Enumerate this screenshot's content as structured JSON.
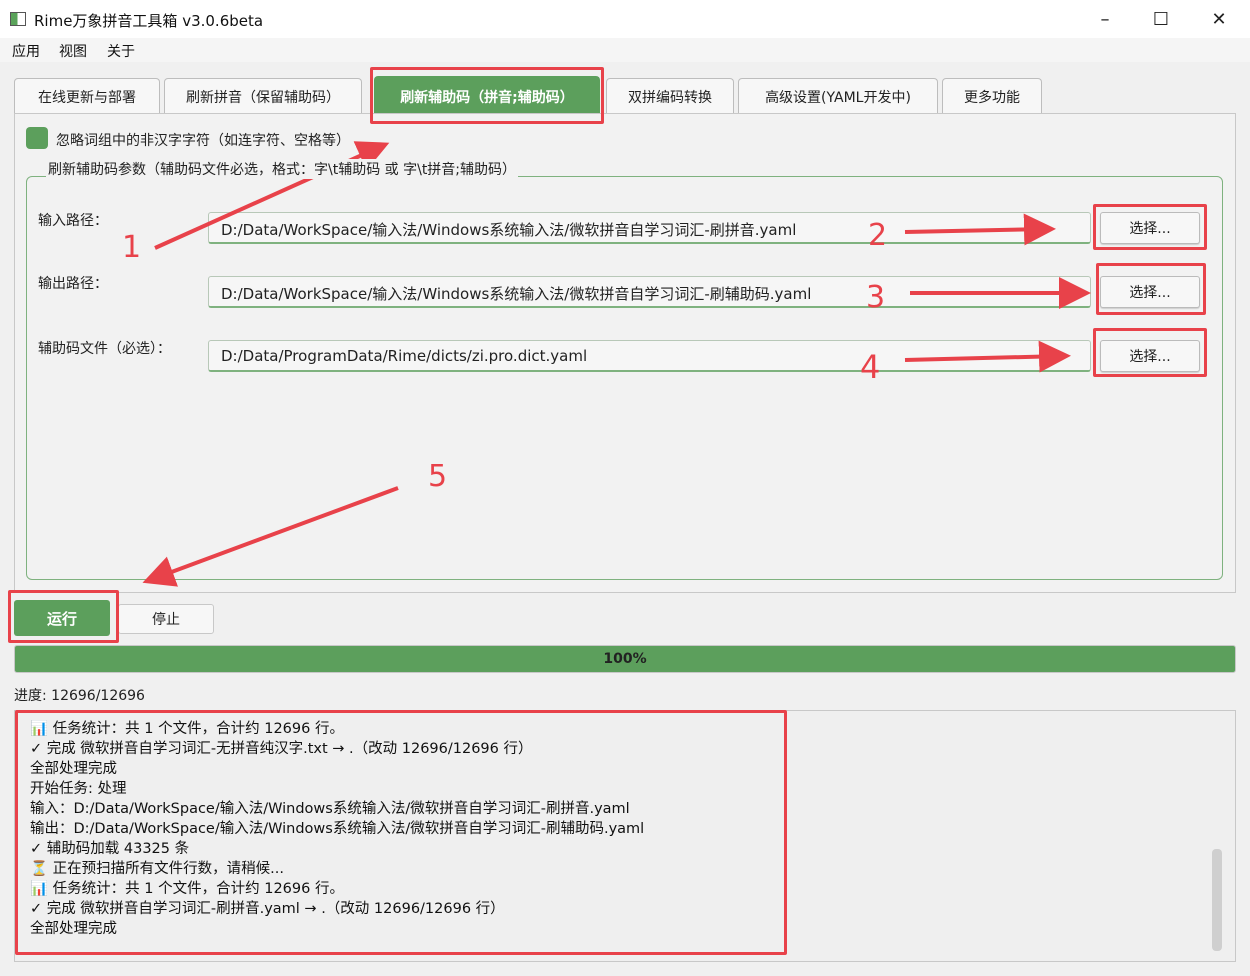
{
  "window": {
    "title": "Rime万象拼音工具箱 v3.0.6beta",
    "minimize_icon": "minimize-icon",
    "maximize_icon": "maximize-icon",
    "close_icon": "close-icon"
  },
  "menu": [
    "应用",
    "视图",
    "关于"
  ],
  "tabs": [
    {
      "label": "在线更新与部署",
      "active": false
    },
    {
      "label": "刷新拼音（保留辅助码）",
      "active": false
    },
    {
      "label": "刷新辅助码（拼音;辅助码）",
      "active": true
    },
    {
      "label": "双拼编码转换",
      "active": false
    },
    {
      "label": "高级设置(YAML开发中)",
      "active": false
    },
    {
      "label": "更多功能",
      "active": false
    }
  ],
  "options": {
    "ignore_non_hanzi": {
      "label": "忽略词组中的非汉字字符（如连字符、空格等）",
      "checked": true
    }
  },
  "params": {
    "group_title": "刷新辅助码参数（辅助码文件必选，格式：字\\t辅助码 或 字\\t拼音;辅助码）",
    "input": {
      "label": "输入路径：",
      "value": "D:/Data/WorkSpace/输入法/Windows系统输入法/微软拼音自学习词汇-刷拼音.yaml",
      "button": "选择..."
    },
    "output": {
      "label": "输出路径：",
      "value": "D:/Data/WorkSpace/输入法/Windows系统输入法/微软拼音自学习词汇-刷辅助码.yaml",
      "button": "选择..."
    },
    "aux": {
      "label": "辅助码文件（必选）：",
      "value": "D:/Data/ProgramData/Rime/dicts/zi.pro.dict.yaml",
      "button": "选择..."
    }
  },
  "actions": {
    "run": "运行",
    "stop": "停止"
  },
  "progress": {
    "percent": 100,
    "text": "100%",
    "status": "进度: 12696/12696"
  },
  "log": [
    "📊 任务统计：共 1 个文件，合计约 12696 行。",
    "✓ 完成 微软拼音自学习词汇-无拼音纯汉字.txt → .（改动 12696/12696 行）",
    "全部处理完成",
    "开始任务: 处理",
    "输入：D:/Data/WorkSpace/输入法/Windows系统输入法/微软拼音自学习词汇-刷拼音.yaml",
    "输出：D:/Data/WorkSpace/输入法/Windows系统输入法/微软拼音自学习词汇-刷辅助码.yaml",
    "✓ 辅助码加载 43325 条",
    "⏳ 正在预扫描所有文件行数，请稍候...",
    "📊 任务统计：共 1 个文件，合计约 12696 行。",
    "✓ 完成 微软拼音自学习词汇-刷拼音.yaml → .（改动 12696/12696 行）",
    "全部处理完成"
  ],
  "annotations": {
    "color": "#e8424a",
    "numbers": [
      "1",
      "2",
      "3",
      "4",
      "5"
    ]
  },
  "colors": {
    "accent": "#5c9f5c"
  }
}
